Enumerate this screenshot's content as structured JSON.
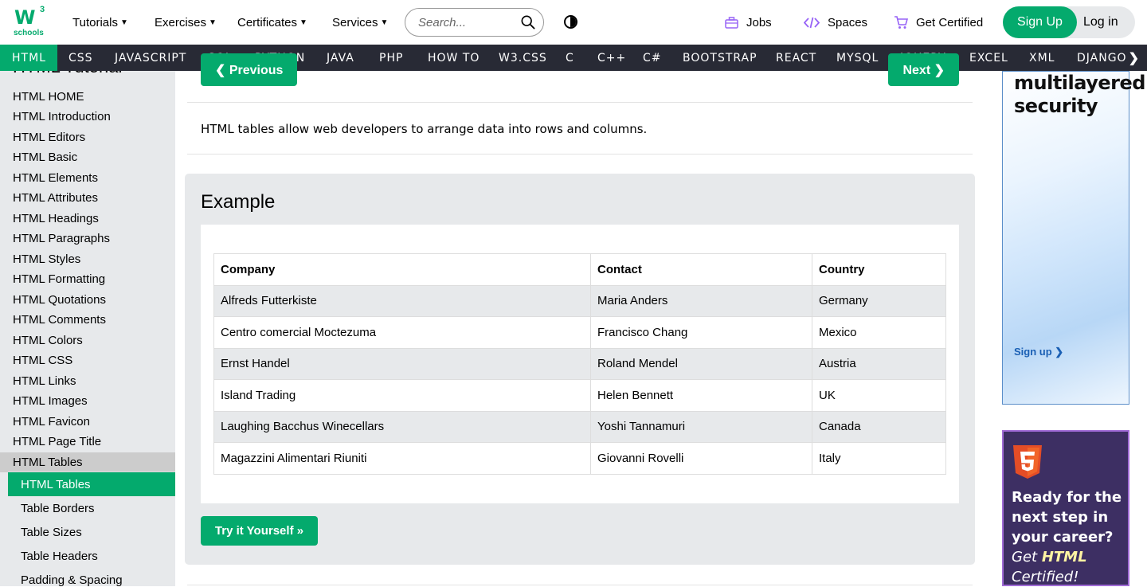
{
  "logo": {
    "letters": "W",
    "superscript": "3",
    "sub": "schools"
  },
  "topmenu": [
    {
      "label": "Tutorials"
    },
    {
      "label": "Exercises"
    },
    {
      "label": "Certificates"
    },
    {
      "label": "Services"
    }
  ],
  "search": {
    "placeholder": "Search..."
  },
  "rightlinks": [
    {
      "label": "Jobs",
      "icon": "briefcase-icon"
    },
    {
      "label": "Spaces",
      "icon": "code-icon"
    },
    {
      "label": "Get Certified",
      "icon": "cart-icon"
    }
  ],
  "auth": {
    "signup": "Sign Up",
    "login": "Log in"
  },
  "subnav": [
    "HTML",
    "CSS",
    "JAVASCRIPT",
    "SQL",
    "PYTHON",
    "JAVA",
    "PHP",
    "HOW TO",
    "W3.CSS",
    "C",
    "C++",
    "C#",
    "BOOTSTRAP",
    "REACT",
    "MYSQL",
    "JQUERY",
    "EXCEL",
    "XML",
    "DJANGO"
  ],
  "subnav_arrow": "❯",
  "sidebar": {
    "title": "HTML Tutorial",
    "links": [
      "HTML HOME",
      "HTML Introduction",
      "HTML Editors",
      "HTML Basic",
      "HTML Elements",
      "HTML Attributes",
      "HTML Headings",
      "HTML Paragraphs",
      "HTML Styles",
      "HTML Formatting",
      "HTML Quotations",
      "HTML Comments",
      "HTML Colors",
      "HTML CSS",
      "HTML Links",
      "HTML Images",
      "HTML Favicon",
      "HTML Page Title",
      "HTML Tables"
    ],
    "sublinks": [
      "HTML Tables",
      "Table Borders",
      "Table Sizes",
      "Table Headers",
      "Padding & Spacing"
    ]
  },
  "main": {
    "prev": "❮ Previous",
    "next": "Next ❯",
    "intro": "HTML tables allow web developers to arrange data into rows and columns.",
    "example_title": "Example",
    "table": {
      "headers": [
        "Company",
        "Contact",
        "Country"
      ],
      "rows": [
        [
          "Alfreds Futterkiste",
          "Maria Anders",
          "Germany"
        ],
        [
          "Centro comercial Moctezuma",
          "Francisco Chang",
          "Mexico"
        ],
        [
          "Ernst Handel",
          "Roland Mendel",
          "Austria"
        ],
        [
          "Island Trading",
          "Helen Bennett",
          "UK"
        ],
        [
          "Laughing Bacchus Winecellars",
          "Yoshi Tannamuri",
          "Canada"
        ],
        [
          "Magazzini Alimentari Riuniti",
          "Giovanni Rovelli",
          "Italy"
        ]
      ]
    },
    "tryit": "Try it Yourself »"
  },
  "ads": {
    "ad1_line1": "multilayered",
    "ad1_line2": "security",
    "ad1_cta": "Sign up ❯",
    "ad2_line1": "Ready for the",
    "ad2_line2": "next step in",
    "ad2_line3": "your career?",
    "ad2_get": "Get ",
    "ad2_html": "HTML",
    "ad2_cert": "Certified!"
  },
  "colors": {
    "brand": "#04AA6D",
    "subnav_bg": "#282A35",
    "sidebar_bg": "#E7E9EB"
  }
}
